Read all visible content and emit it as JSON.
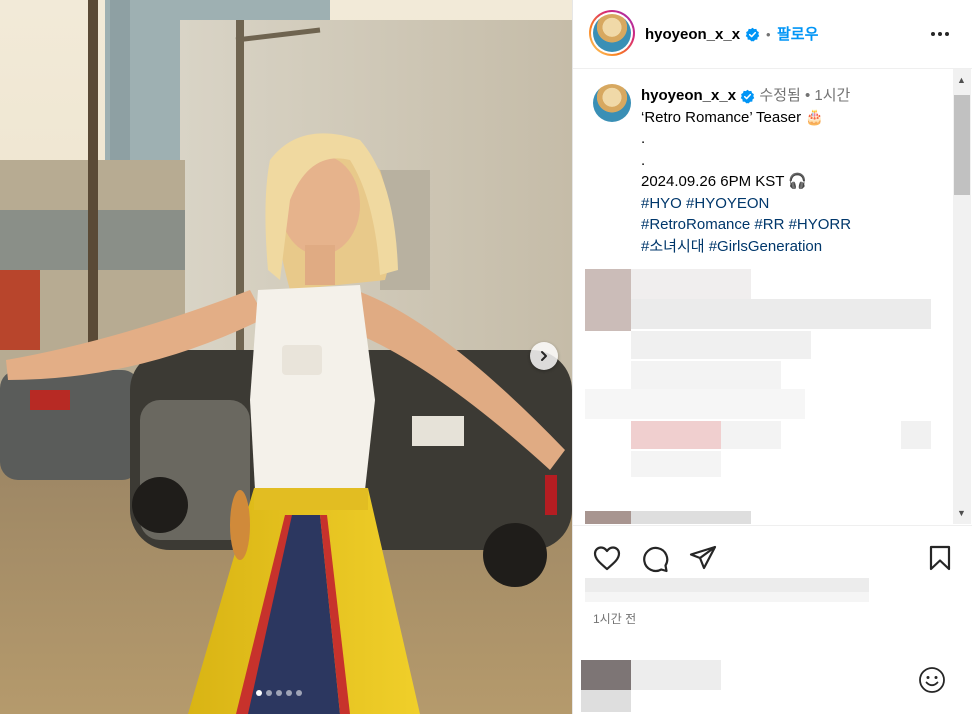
{
  "header": {
    "username": "hyoyeon_x_x",
    "separator": "•",
    "follow_label": "팔로우"
  },
  "caption": {
    "username": "hyoyeon_x_x",
    "edited_label": "수정됨",
    "separator": "•",
    "time": "1시간",
    "lines": [
      "‘Retro Romance’ Teaser 🎂",
      ".",
      ".",
      "2024.09.26 6PM KST 🎧"
    ],
    "hashtags": [
      [
        "#HYO",
        "#HYOYEON"
      ],
      [
        "#RetroRomance",
        "#RR",
        "#HYORR"
      ],
      [
        "#소녀시대",
        "#GirlsGeneration"
      ]
    ]
  },
  "post": {
    "time_ago": "1시간 전",
    "carousel_total": 5,
    "carousel_active": 0
  },
  "icons": [
    "verified-badge-icon",
    "more-icon",
    "chevron-right-icon",
    "heart-icon",
    "comment-icon",
    "share-icon",
    "bookmark-icon",
    "emoji-icon"
  ],
  "colors": {
    "accent": "#0095f6",
    "hashtag": "#00376b",
    "meta": "#737373"
  }
}
